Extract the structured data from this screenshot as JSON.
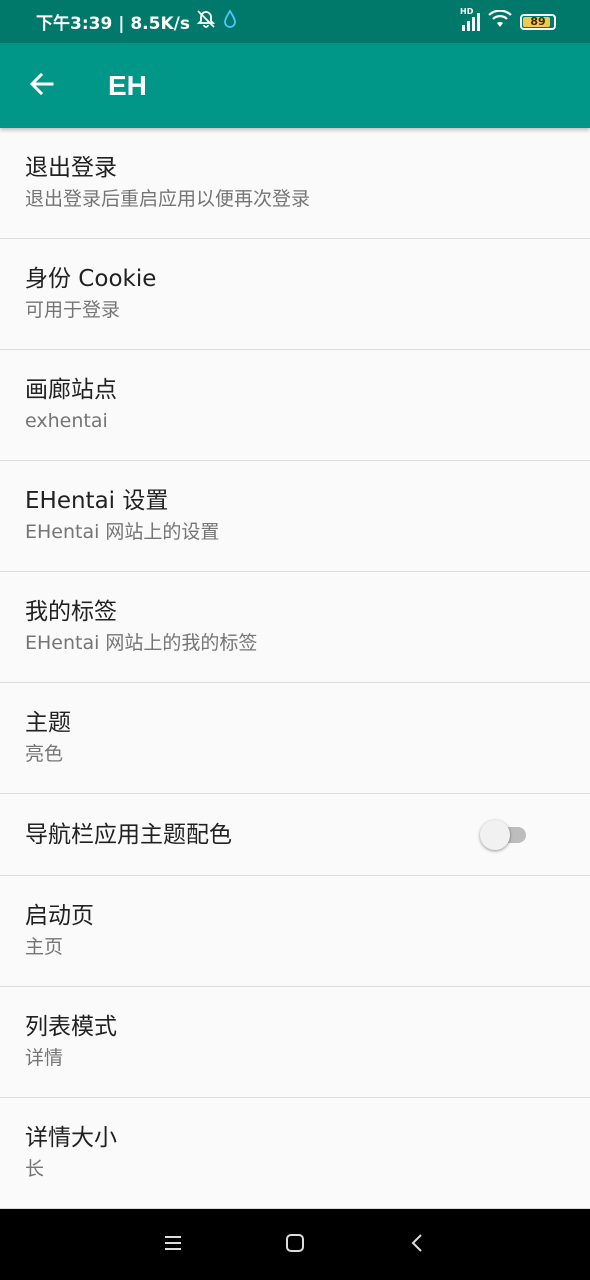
{
  "status_bar": {
    "time_speed": "下午3:39 | 8.5K/s",
    "hd_label": "HD",
    "battery_level": "89",
    "battery_fraction": 0.89,
    "battery_color": "#f2c94c"
  },
  "app_bar": {
    "title": "EH",
    "back_icon": "arrow-back-icon",
    "color": "#009688"
  },
  "settings": [
    {
      "title": "退出登录",
      "summary": "退出登录后重启应用以便再次登录"
    },
    {
      "title": "身份 Cookie",
      "summary": "可用于登录"
    },
    {
      "title": "画廊站点",
      "summary": "exhentai"
    },
    {
      "title": "EHentai 设置",
      "summary": "EHentai 网站上的设置"
    },
    {
      "title": "我的标签",
      "summary": "EHentai 网站上的我的标签"
    },
    {
      "title": "主题",
      "summary": "亮色"
    },
    {
      "title": "导航栏应用主题配色",
      "switch_on": false
    },
    {
      "title": "启动页",
      "summary": "主页"
    },
    {
      "title": "列表模式",
      "summary": "详情"
    },
    {
      "title": "详情大小",
      "summary": "长"
    }
  ],
  "nav_bar": {
    "menu_icon": "menu-icon",
    "home_icon": "home-icon",
    "back_icon": "back-icon"
  }
}
